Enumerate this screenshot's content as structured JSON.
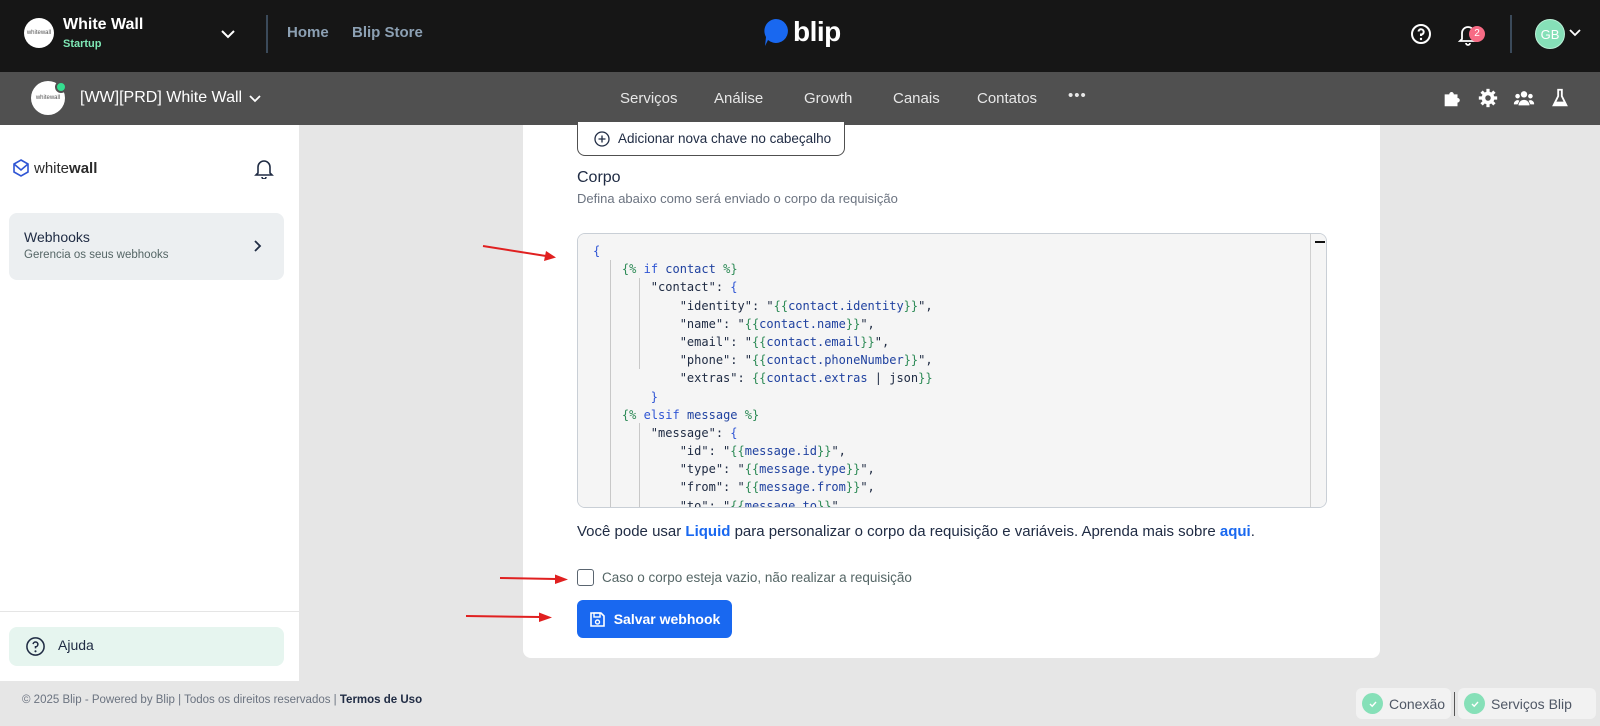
{
  "topbar": {
    "org_name": "White Wall",
    "org_plan": "Startup",
    "org_logo_text": "whitewall",
    "nav": [
      {
        "label": "Home"
      },
      {
        "label": "Blip Store"
      }
    ],
    "brand": "blip",
    "notifications_count": "2",
    "avatar_initials": "GB"
  },
  "subbar": {
    "bot_name": "[WW][PRD] White Wall",
    "nav": [
      {
        "label": "Serviços"
      },
      {
        "label": "Análise"
      },
      {
        "label": "Growth"
      },
      {
        "label": "Canais"
      },
      {
        "label": "Contatos"
      }
    ],
    "more_label": "•••"
  },
  "sidebar": {
    "logo_light": "white",
    "logo_bold": "wall",
    "items": [
      {
        "title": "Webhooks",
        "subtitle": "Gerencia os seus webhooks"
      }
    ],
    "help_label": "Ajuda"
  },
  "main": {
    "add_header_label": "Adicionar nova chave no cabeçalho",
    "body_title": "Corpo",
    "body_desc": "Defina abaixo como será enviado o corpo da requisição",
    "liquid_hint_pre": "Você pode usar ",
    "liquid_link": "Liquid",
    "liquid_hint_mid": " para personalizar o corpo da requisição e variáveis. Aprenda mais sobre ",
    "liquid_here": "aqui",
    "liquid_hint_end": ".",
    "skip_empty_label": "Caso o corpo esteja vazio, não realizar a requisição",
    "skip_empty_checked": false,
    "save_label": "Salvar webhook"
  },
  "footer": {
    "copyright": "© 2025 Blip - Powered by Blip | Todos os direitos reservados | ",
    "terms": "Termos de Uso",
    "status": [
      {
        "label": "Conexão"
      },
      {
        "label": "Serviços Blip"
      }
    ]
  },
  "colors": {
    "accent": "#1968f0",
    "topbar": "#161616",
    "subbar": "#505050",
    "success": "#86e0b8",
    "badge": "#f76b85",
    "arrow": "#e02020"
  },
  "icons": [
    "chevron-down-icon",
    "help-circle-icon",
    "bell-icon",
    "puzzle-icon",
    "gear-icon",
    "users-icon",
    "flask-icon",
    "chevron-right-icon",
    "plus-circle-icon",
    "save-icon",
    "check-icon"
  ]
}
